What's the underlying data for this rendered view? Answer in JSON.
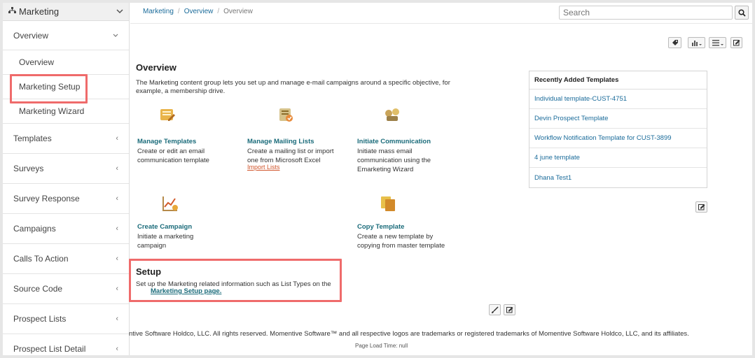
{
  "sidebar": {
    "header": "Marketing",
    "items": [
      {
        "label": "Overview",
        "type": "group"
      },
      {
        "label": "Overview",
        "type": "sub"
      },
      {
        "label": "Marketing Setup",
        "type": "sub"
      },
      {
        "label": "Marketing Wizard",
        "type": "sub"
      },
      {
        "label": "Templates",
        "type": "group"
      },
      {
        "label": "Surveys",
        "type": "group"
      },
      {
        "label": "Survey Response",
        "type": "group"
      },
      {
        "label": "Campaigns",
        "type": "group"
      },
      {
        "label": "Calls To Action",
        "type": "group"
      },
      {
        "label": "Source Code",
        "type": "group"
      },
      {
        "label": "Prospect Lists",
        "type": "group"
      },
      {
        "label": "Prospect List Detail",
        "type": "group"
      }
    ]
  },
  "breadcrumb": [
    "Marketing",
    "Overview",
    "Overview"
  ],
  "search": {
    "placeholder": "Search"
  },
  "overview": {
    "title": "Overview",
    "description": "The Marketing content group lets you set up and manage e-mail campaigns around a specific objective, for example, a membership drive."
  },
  "tiles": [
    {
      "title": "Manage Templates",
      "desc": "Create or edit an email communication template",
      "link": ""
    },
    {
      "title": "Manage Mailing Lists",
      "desc": "Create a mailing list or import one from Microsoft Excel",
      "link": "Import Lists"
    },
    {
      "title": "Initiate Communication",
      "desc": "Initiate mass email communication using the Emarketing Wizard",
      "link": ""
    },
    {
      "title": "Create Campaign",
      "desc": "Initiate a marketing campaign",
      "link": ""
    },
    {
      "title": "Copy Template",
      "desc": "Create a new template by copying from master template",
      "link": ""
    }
  ],
  "setup": {
    "title": "Setup",
    "description": "Set up the Marketing related information such as List Types on the",
    "link": "Marketing Setup page."
  },
  "recent": {
    "title": "Recently Added Templates",
    "items": [
      "Individual template-CUST-4751",
      "Devin Prospect Template",
      "Workflow Notification Template for CUST-3899",
      "4 june template",
      "Dhana Test1"
    ]
  },
  "footer": {
    "copyright": "ntive Software Holdco, LLC. All rights reserved. Momentive Software™ and all respective logos are trademarks or registered trademarks of Momentive Software Holdco, LLC, and its affiliates.",
    "load_time": "Page Load Time: null"
  },
  "colors": {
    "highlight": "#ef6b6b",
    "link": "#1a6b7a",
    "accent_link": "#d0542a"
  }
}
